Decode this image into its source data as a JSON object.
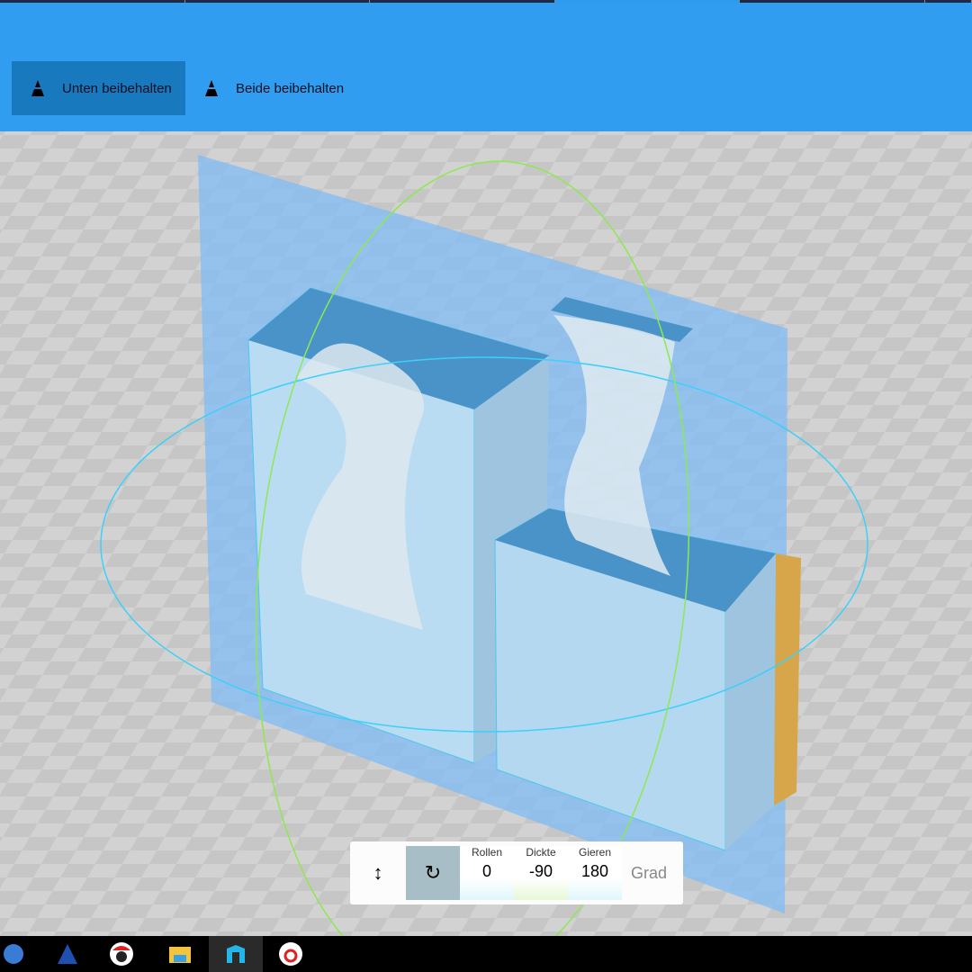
{
  "toolbar": {
    "keep_bottom": "Unten beibehalten",
    "keep_both": "Beide beibehalten"
  },
  "transform_panel": {
    "move_icon": "move-icon",
    "rotate_icon": "rotate-icon",
    "fields": [
      {
        "label": "Rollen",
        "value": "0"
      },
      {
        "label": "Dickte",
        "value": "-90"
      },
      {
        "label": "Gieren",
        "value": "180"
      }
    ],
    "unit": "Grad"
  },
  "taskbar": {
    "icons": [
      "network-icon",
      "wizard-icon",
      "avatar-icon",
      "file-explorer-icon",
      "3d-builder-icon",
      "red-app-icon"
    ]
  },
  "colors": {
    "accent": "#319df0",
    "selected": "#1879bf"
  }
}
